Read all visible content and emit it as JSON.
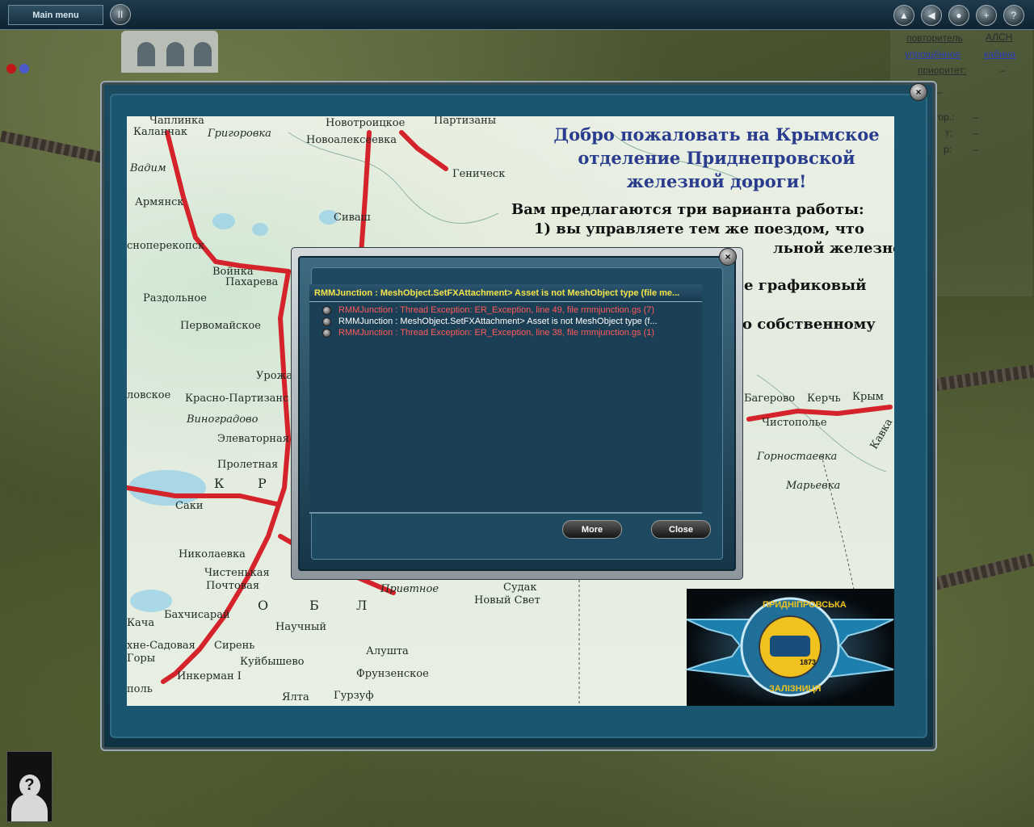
{
  "topbar": {
    "main_menu_label": "Main menu",
    "pause_symbol": "II",
    "right_icons": [
      "eject-icon",
      "rewind-icon",
      "record-icon",
      "plus-icon",
      "help-icon"
    ],
    "plus_symbol": "+",
    "help_symbol": "?"
  },
  "info_panel": {
    "col1_header": "повторитель",
    "col2_header": "АЛСН",
    "col1_link": "упрощённое",
    "col2_link": "кабина",
    "priority_label": "приоритет:",
    "priority_value": "–",
    "dash_row": "–",
    "row2_label": "тор.:",
    "row2_value": "–",
    "row3_label": "т:",
    "row3_value": "–",
    "row4_label": "р:",
    "row4_value": "–"
  },
  "welcome": {
    "heading_line1": "Добро пожаловать на Крымское",
    "heading_line2": "отделение Приднепровской",
    "heading_line3": "железной дороги!",
    "intro_line1": "Вам предлагаются три варианта работы:",
    "intro_line2": "1) вы управляете тем же поездом, что",
    "intro_line3": "льной железной",
    "intro_line4": "е   графиковый",
    "intro_line5": "о собственному"
  },
  "map_labels": [
    "Чаплинка",
    "Каланчак",
    "Григоровка",
    "Новотроицкое",
    "Партизаны",
    "Новоалексеевка",
    "Вадим",
    "Армянск",
    "Геническ",
    "Сиваш",
    "сноперекопск",
    "Войнка",
    "Пахарева",
    "Раздольное",
    "Первомайское",
    "Урожа",
    "Красно-Партизанс",
    "Виноградово",
    "Элеваторная",
    "Пролетная",
    "Саки",
    "Николаевка",
    "Чистенькая",
    "Почтовая",
    "Бахчисарай",
    "Кача",
    "Научный",
    "Сирень",
    "Куйбышево",
    "Инкерман I",
    "Алушта",
    "Фрунзенское",
    "Ялта",
    "Гурзуф",
    "Судак",
    "Новый Свет",
    "Привтное",
    "Багерово",
    "Керчь",
    "Крым",
    "Чистополье",
    "Горностаевка",
    "Марьевка",
    "Кавка",
    "ловское",
    "хне-Садовая",
    "Горы",
    "поль"
  ],
  "map_lettering": [
    "К",
    "Р",
    "О",
    "Б",
    "Л"
  ],
  "logo": {
    "top_text": "ПРИДНІПРОВСЬКА",
    "bottom_text": "ЗАЛІЗНИЦЯ",
    "year": "1873"
  },
  "error_dialog": {
    "title": "RMMJunction : MeshObject.SetFXAttachment> Asset is not MeshObject type (file me...",
    "messages": [
      {
        "text": "RMMJunction : Thread Exception: ER_Exception, line 49, file rmmjunction.gs (7)",
        "color": "#ff5a5a"
      },
      {
        "text": "RMMJunction : MeshObject.SetFXAttachment> Asset is not MeshObject type (f...",
        "color": "#ffffff"
      },
      {
        "text": "RMMJunction : Thread Exception: ER_Exception, line 38, file rmmjunction.gs (1)",
        "color": "#ff5a5a"
      }
    ],
    "more_label": "More",
    "close_label": "Close"
  },
  "outer_close_symbol": "×",
  "dialog_close_symbol": "×",
  "avatar_symbol": "?"
}
